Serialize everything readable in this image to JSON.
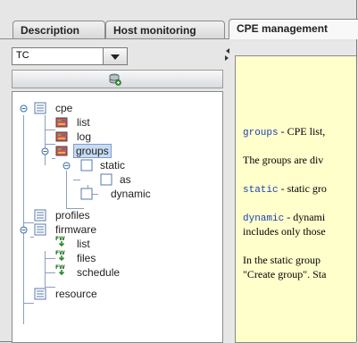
{
  "tabs": [
    {
      "label": "Description",
      "active": false
    },
    {
      "label": "Host monitoring",
      "active": false
    },
    {
      "label": "CPE management",
      "active": true
    }
  ],
  "filter_combo": {
    "value": "TC"
  },
  "toolbar": {
    "icon": "database-refresh-icon"
  },
  "tree": {
    "cpe": "cpe",
    "list": "list",
    "log": "log",
    "groups": "groups",
    "static": "static",
    "as": "as",
    "dynamic": "dynamic",
    "profiles": "profiles",
    "firmware": "firmware",
    "fw_list": "list",
    "fw_files": "files",
    "fw_schedule": "schedule",
    "resource": "resource"
  },
  "doc": {
    "groups_term": "groups",
    "groups_desc": " - CPE list,",
    "groups_div": "The groups are div",
    "static_term": "static",
    "static_desc": " - static gro",
    "dynamic_term": "dynamic",
    "dynamic_desc": " - dynami",
    "dynamic_desc2": "includes only those",
    "static_group_1": "In the static group",
    "static_group_2": "\"Create group\". Sta"
  },
  "colors": {
    "doc_bg": "#ffffcc",
    "selection": "#c9daf3",
    "keyword": "#1a3fb0"
  }
}
